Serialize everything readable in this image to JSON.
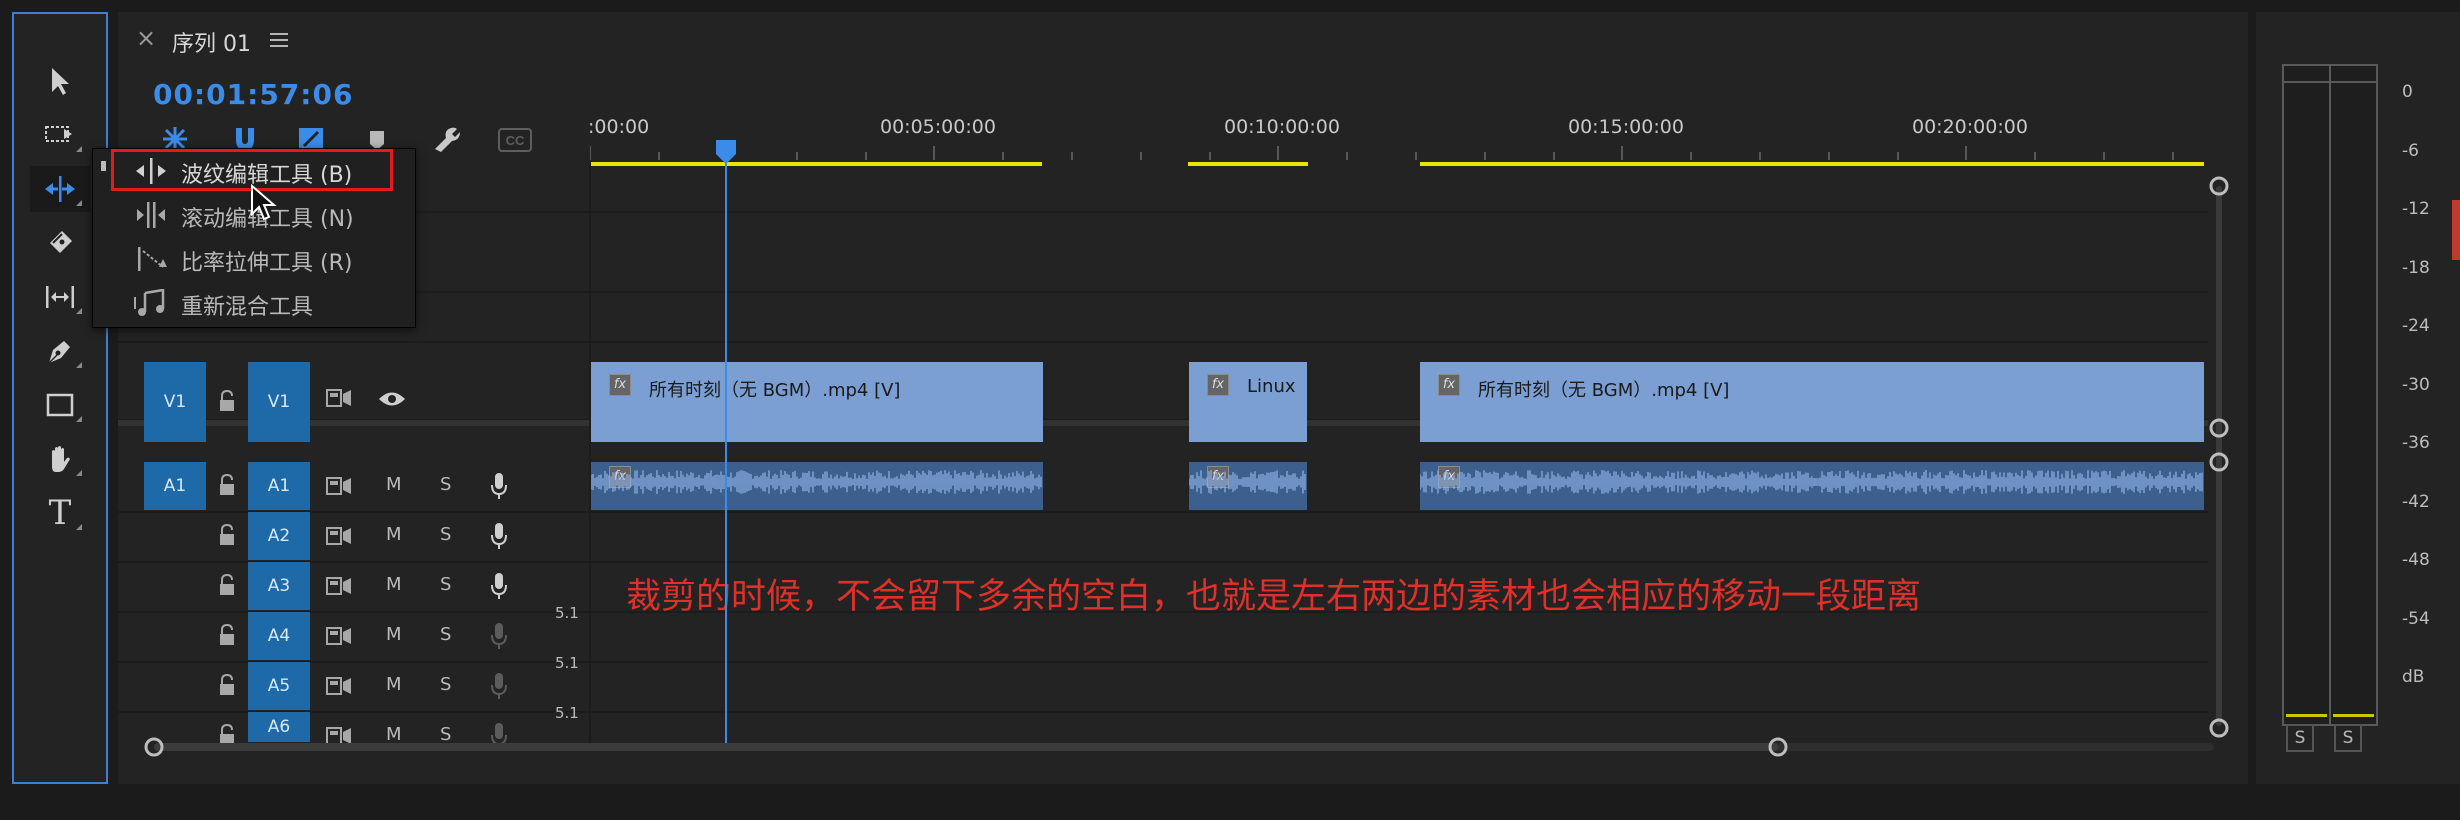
{
  "sequence_tab": {
    "close": "×",
    "title": "序列 01",
    "menu_icon": "hamburger-icon"
  },
  "timecode": "00:01:57:06",
  "ruler": {
    "labels": [
      ":00:00",
      "00:05:00:00",
      "00:10:00:00",
      "00:15:00:00",
      "00:20:00:00"
    ]
  },
  "tools": [
    {
      "name": "selection-tool",
      "icon": "arrow-icon"
    },
    {
      "name": "track-select-tool",
      "icon": "track-select-icon"
    },
    {
      "name": "ripple-edit-tool",
      "icon": "ripple-edit-icon",
      "active": true
    },
    {
      "name": "razor-tool",
      "icon": "razor-icon"
    },
    {
      "name": "slip-tool",
      "icon": "slip-icon"
    },
    {
      "name": "pen-tool",
      "icon": "pen-icon"
    },
    {
      "name": "rectangle-tool",
      "icon": "rectangle-icon"
    },
    {
      "name": "hand-tool",
      "icon": "hand-icon"
    },
    {
      "name": "type-tool",
      "icon": "type-icon",
      "label": "T"
    }
  ],
  "flyout_menu": [
    {
      "label": "波纹编辑工具 (B)",
      "highlighted": true
    },
    {
      "label": "滚动编辑工具 (N)"
    },
    {
      "label": "比率拉伸工具 (R)"
    },
    {
      "label": "重新混合工具"
    }
  ],
  "video_track": {
    "source": "V1",
    "target": "V1"
  },
  "audio_tracks": [
    {
      "source": "A1",
      "target": "A1",
      "m": "M",
      "s": "S",
      "channels": ""
    },
    {
      "source": "",
      "target": "A2",
      "m": "M",
      "s": "S",
      "channels": ""
    },
    {
      "source": "",
      "target": "A3",
      "m": "M",
      "s": "S",
      "channels": ""
    },
    {
      "source": "",
      "target": "A4",
      "m": "M",
      "s": "S",
      "channels": "5.1"
    },
    {
      "source": "",
      "target": "A5",
      "m": "M",
      "s": "S",
      "channels": "5.1"
    },
    {
      "source": "",
      "target": "A6",
      "m": "M",
      "s": "S",
      "channels": "5.1"
    }
  ],
  "clips": {
    "video": [
      {
        "title": "所有时刻（无 BGM）.mp4 [V]",
        "fx": "fx"
      },
      {
        "title": "Linux",
        "fx": "fx"
      },
      {
        "title": "所有时刻（无 BGM）.mp4 [V]",
        "fx": "fx"
      }
    ],
    "audio_fx": "fx"
  },
  "annotation": "裁剪的时候，不会留下多余的空白，也就是左右两边的素材也会相应的移动一段距离",
  "meter": {
    "scale": [
      "0",
      "-6",
      "-12",
      "-18",
      "-24",
      "-30",
      "-36",
      "-42",
      "-48",
      "-54",
      "dB"
    ],
    "solo_left": "S",
    "solo_right": "S"
  },
  "colors": {
    "accent": "#3b8be8",
    "video_clip": "#7b9fd3",
    "audio_clip": "#3c5f8d",
    "track_target": "#1e6aa8",
    "work_area": "#e6e600",
    "annotation": "#e0302a",
    "highlight_box": "#e21b1b"
  }
}
